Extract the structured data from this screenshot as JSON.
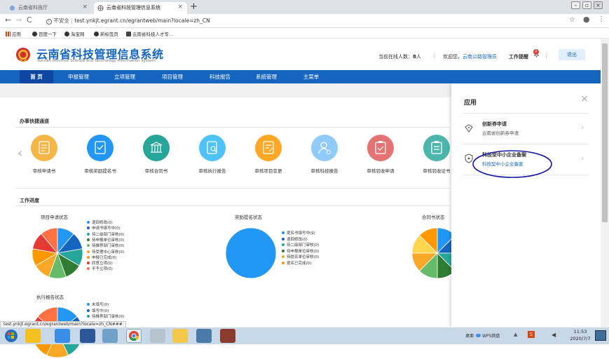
{
  "browser": {
    "tabs": [
      {
        "title": "云南省科技厅",
        "active": false
      },
      {
        "title": "云南省科技管理信息系统",
        "active": true
      }
    ],
    "new_tab": "+",
    "security_label": "不安全",
    "url": "test.ynkjt.egrant.cn/egrantweb/main?locale=zh_CN",
    "bookmarks": [
      "应用",
      "百度一下",
      "淘宝网",
      "新标签页",
      "云南省科技人才专..."
    ],
    "status_url": "test.ynkjt.egrant.cn/egrantweb/main?locale=zh_CN###"
  },
  "header": {
    "title": "云南省科技管理信息系统",
    "subtitle": "Yunnan Province Science and Technology Information System",
    "online_label": "当前在线人数：",
    "online_count": "8",
    "online_unit": "人",
    "welcome": "欢迎您，",
    "username": "云南公路管理员",
    "reminder": "工作提醒",
    "reminder_count": "0",
    "logout": "退出"
  },
  "nav": [
    "首 页",
    "申报管理",
    "立项管理",
    "项目管理",
    "科技报告",
    "系统管理",
    "主菜单"
  ],
  "quick": {
    "title": "办事快捷通道",
    "items": [
      {
        "label": "审核申请书",
        "color": "#f5b547"
      },
      {
        "label": "审核奖励提名书",
        "color": "#2196f3"
      },
      {
        "label": "审核合同书",
        "color": "#26a69a"
      },
      {
        "label": "审核执行报告",
        "color": "#4fc3f7"
      },
      {
        "label": "审核项目变更",
        "color": "#ffa726"
      },
      {
        "label": "审核科技报告",
        "color": "#90caf9"
      },
      {
        "label": "审核验收申请",
        "color": "#e57373"
      },
      {
        "label": "审核验收证书",
        "color": "#4db6ac"
      }
    ]
  },
  "progress": {
    "title": "工作进度",
    "chart_data": [
      {
        "type": "pie",
        "title": "项目申请状态",
        "categories": [
          "退回修改(0)",
          "申请书填写中(0)",
          "待二级部门审核(0)",
          "待申报单位审核(0)",
          "待推荐部门审核(0)",
          "待受理中心审核(0)",
          "申报已完成(0)",
          "同意立项(0)",
          "不予立项(0)"
        ],
        "values": [
          1,
          1,
          1,
          1,
          1,
          1,
          1,
          1,
          1
        ],
        "colors": [
          "#2196f3",
          "#1565c0",
          "#26a69a",
          "#2e7d32",
          "#66bb6a",
          "#f9a825",
          "#ff9800",
          "#e53935",
          "#ff7043"
        ]
      },
      {
        "type": "pie",
        "title": "奖励提名状态",
        "categories": [
          "提名书填写中(9)",
          "退回修改(0)",
          "待二级部门审核(0)",
          "待申报单位审核(0)",
          "待提名单位审核(0)",
          "提名已完成(0)"
        ],
        "values": [
          9,
          0,
          0,
          0,
          0,
          0
        ],
        "colors": [
          "#2196f3",
          "#1565c0",
          "#26a69a",
          "#2e7d32",
          "#f9a825",
          "#ff9800"
        ]
      },
      {
        "type": "pie",
        "title": "合同书状态",
        "categories": [],
        "values": [
          1,
          1,
          1,
          1,
          1,
          1,
          1,
          1
        ],
        "colors": [
          "#2196f3",
          "#1565c0",
          "#26a69a",
          "#2e7d32",
          "#66bb6a",
          "#f9a825",
          "#ffd54f",
          "#ff9800"
        ]
      },
      {
        "type": "pie",
        "title": "执行报告状态",
        "categories": [
          "未填写(0)",
          "填写中(0)",
          "待推荐部门审核(0)"
        ],
        "values": [
          1,
          1,
          1,
          1,
          1,
          1,
          1
        ],
        "colors": [
          "#2196f3",
          "#1565c0",
          "#26a69a",
          "#f9a825",
          "#ff9800",
          "#e53935",
          "#ff7043"
        ]
      }
    ]
  },
  "app_panel": {
    "title": "应用",
    "items": [
      {
        "title": "创新券申请",
        "desc": "云南省创新券申请"
      },
      {
        "title": "科技型中小企业备案",
        "desc": "科技型中小企业备案"
      }
    ]
  },
  "taskbar": {
    "tray_label": "桌面",
    "wps_label": "WPS网盘",
    "ime_label": "S",
    "time": "11:53",
    "date": "2020/7/7"
  }
}
